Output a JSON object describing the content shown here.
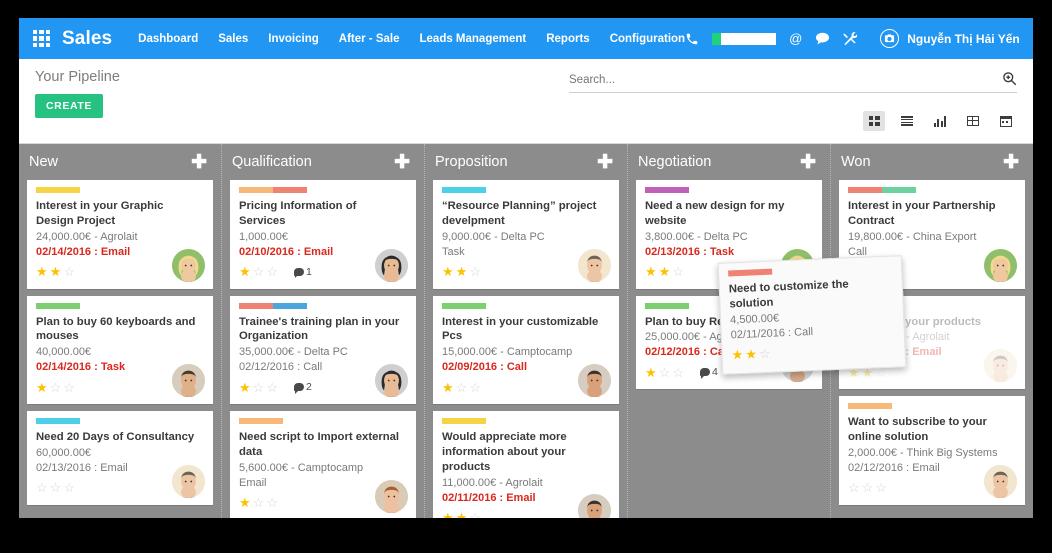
{
  "navbar": {
    "apps_icon": "apps-grid-icon",
    "brand": "Sales",
    "menu": [
      {
        "label": "Dashboard"
      },
      {
        "label": "Sales"
      },
      {
        "label": "Invoicing"
      },
      {
        "label": "After - Sale"
      },
      {
        "label": "Leads Management"
      },
      {
        "label": "Reports"
      },
      {
        "label": "Configuration"
      }
    ],
    "icons": [
      {
        "name": "phone-icon",
        "glyph": "✆"
      },
      {
        "name": "at-icon",
        "glyph": "@"
      },
      {
        "name": "chat-bubble-icon",
        "glyph": "⬬"
      },
      {
        "name": "tools-icon",
        "glyph": "⚒"
      }
    ],
    "progress_label": "",
    "user_name": "Nguyễn Thị Hải Yến",
    "accent_color": "#2196f3",
    "progress_color": "#21d07a"
  },
  "control_panel": {
    "title": "Your Pipeline",
    "create_label": "CREATE",
    "create_color": "#26c281",
    "search_placeholder": "Search...",
    "search_value": "",
    "search_icon": "search-icon",
    "views": [
      {
        "name": "kanban",
        "active": true
      },
      {
        "name": "list",
        "active": false
      },
      {
        "name": "graph",
        "active": false
      },
      {
        "name": "pivot",
        "active": false
      },
      {
        "name": "calendar",
        "active": false
      }
    ]
  },
  "board": {
    "add_label": "✚",
    "columns": [
      {
        "title": "New",
        "cards": [
          {
            "tags": [
              "#f5d547"
            ],
            "title": "Interest in your Graphic Design Project",
            "amount": "24,000.00€ - Agrolait",
            "date": "02/14/2016 : Email",
            "urgent": true,
            "stars": 2,
            "messages": "",
            "avatar": "woman-blonde"
          },
          {
            "tags": [
              "#7bcf6e"
            ],
            "title": "Plan to buy 60 keyboards and mouses",
            "amount": "40,000.00€",
            "date": "02/14/2016 : Task",
            "urgent": true,
            "stars": 1,
            "messages": "",
            "avatar": "man-beard"
          },
          {
            "tags": [
              "#4ecfe8"
            ],
            "title": "Need 20 Days of Consultancy",
            "amount": "60,000.00€",
            "date": "02/13/2016 : Email",
            "urgent": false,
            "stars": 0,
            "messages": "",
            "avatar": "man-short"
          }
        ]
      },
      {
        "title": "Qualification",
        "cards": [
          {
            "tags": [
              "#f7b878",
              "#ef8273"
            ],
            "title": "Pricing Information of Services",
            "amount": "1,000.00€",
            "date": "02/10/2016 : Email",
            "urgent": true,
            "stars": 1,
            "messages": "1",
            "avatar": "woman-dark"
          },
          {
            "tags": [
              "#ef8273",
              "#4ba6e0"
            ],
            "title": "Trainee's training plan in your Organization",
            "amount": "35,000.00€ - Delta PC",
            "date": "02/12/2016 : Call",
            "urgent": false,
            "stars": 1,
            "messages": "2",
            "avatar": "woman-dark"
          },
          {
            "tags": [
              "#f7b878"
            ],
            "title": "Need script to Import external data",
            "amount": "5,600.00€ - Camptocamp",
            "date": "Email",
            "urgent": false,
            "stars": 1,
            "messages": "",
            "avatar": "man-ginger"
          }
        ]
      },
      {
        "title": "Proposition",
        "cards": [
          {
            "tags": [
              "#4ecfe8"
            ],
            "title": "“Resource Planning” project develpment",
            "amount": "9,000.00€ - Delta PC",
            "date": "Task",
            "urgent": false,
            "stars": 2,
            "messages": "",
            "avatar": "man-short"
          },
          {
            "tags": [
              "#7bcf6e"
            ],
            "title": "Interest in your customizable Pcs",
            "amount": "15,000.00€ - Camptocamp",
            "date": "02/09/2016 : Call",
            "urgent": true,
            "stars": 1,
            "messages": "",
            "avatar": "man-suit"
          },
          {
            "tags": [
              "#f5d547"
            ],
            "title": "Would appreciate more information about your products",
            "amount": "11,000.00€ - Agrolait",
            "date": "02/11/2016 : Email",
            "urgent": true,
            "stars": 2,
            "messages": "",
            "avatar": "man-suit"
          }
        ]
      },
      {
        "title": "Negotiation",
        "cards": [
          {
            "tags": [
              "#c061b8"
            ],
            "title": "Need a new design for my website",
            "amount": "3,800.00€ - Delta PC",
            "date": "02/13/2016 : Task",
            "urgent": true,
            "stars": 2,
            "messages": "",
            "avatar": "woman-blonde"
          },
          {
            "tags": [
              "#7bcf6e"
            ],
            "title": "Plan to buy RedHat servers",
            "amount": "25,000.00€ - Agrolait",
            "date": "02/12/2016 : Call",
            "urgent": true,
            "stars": 1,
            "messages": "4",
            "avatar": "man-suit-dark"
          }
        ]
      },
      {
        "title": "Won",
        "cards": [
          {
            "tags": [
              "#ef8273",
              "#6bd2a0"
            ],
            "title": "Interest in your Partnership Contract",
            "amount": "19,800.00€ - China Export",
            "date": "Call",
            "urgent": false,
            "stars": 2,
            "messages": "",
            "avatar": "woman-blonde"
          },
          {
            "tags": [
              "#f5d547"
            ],
            "title": "Interest in your products",
            "amount": "27,000.00€ - Agrolait",
            "date": "02/11/2016 : Email",
            "urgent": true,
            "stars": 2,
            "messages": "",
            "avatar": "man-short",
            "obscured": true
          },
          {
            "tags": [
              "#f7b878"
            ],
            "title": "Want to subscribe to your online solution",
            "amount": "2,000.00€ - Think Big Systems",
            "date": "02/12/2016 : Email",
            "urgent": false,
            "stars": 0,
            "messages": "",
            "avatar": "man-short"
          }
        ]
      }
    ]
  },
  "drag_card": {
    "tags": [
      "#ef8273"
    ],
    "title": "Need to customize the solution",
    "amount": "4,500.00€",
    "date": "02/11/2016 : Call",
    "urgent": false,
    "stars": 2,
    "messages": "",
    "avatar": "woman-dark"
  }
}
